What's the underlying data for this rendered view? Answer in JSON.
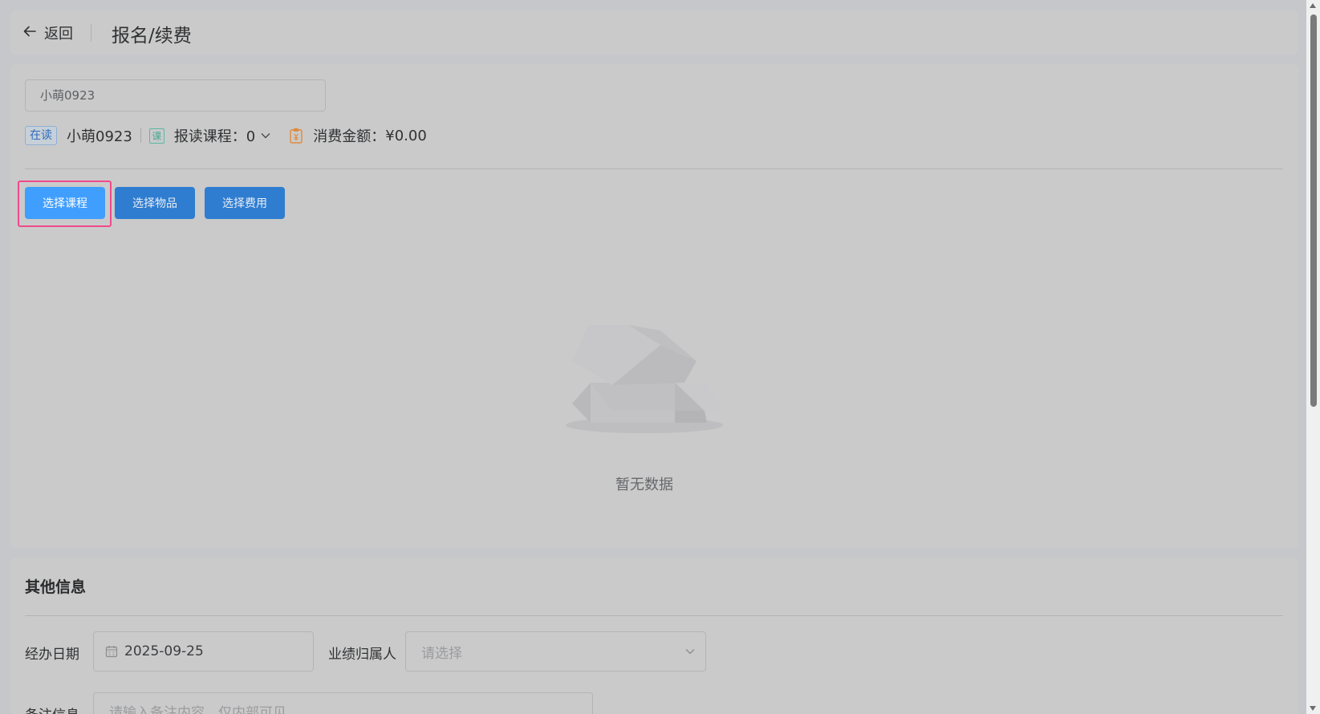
{
  "header": {
    "back_label": "返回",
    "title": "报名/续费"
  },
  "student": {
    "search_value": "小萌0923",
    "status_tag": "在读",
    "name": "小萌0923",
    "course_icon_char": "课",
    "course_label": "报读课程：0",
    "fee_label": "消费金额：",
    "fee_value": "¥0.00"
  },
  "buttons": {
    "select_course": "选择课程",
    "select_item": "选择物品",
    "select_fee": "选择费用"
  },
  "empty_state": {
    "text": "暂无数据"
  },
  "other_info": {
    "title": "其他信息",
    "date_label": "经办日期",
    "date_value": "2025-09-25",
    "owner_label": "业绩归属人",
    "owner_placeholder": "请选择",
    "remark_label": "备注信息",
    "remark_placeholder": "请输入备注内容，仅内部可见"
  },
  "colors": {
    "primary": "#409eff",
    "highlight": "#f04a8c",
    "course_icon": "#59b7a3",
    "fee_icon": "#e08a3c"
  }
}
